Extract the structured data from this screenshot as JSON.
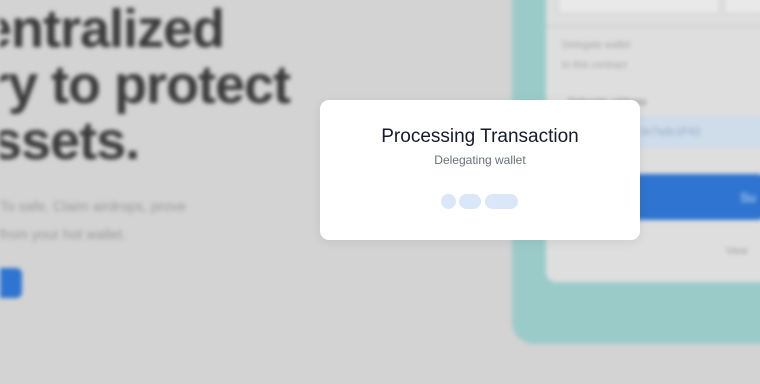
{
  "background": {
    "hero_lines": [
      "entralized",
      "ry to protect",
      "ssets."
    ],
    "subtext_lines": [
      "To safe. Claim airdrops, prove",
      "from your hot wallet."
    ],
    "side_card": {
      "info_lines": [
        "Delegate wallet",
        "to this contract"
      ],
      "field_label": "Delegate address",
      "field_value": "0x7a3c1F42",
      "submit_label": "Su",
      "footer_link": "View"
    }
  },
  "dialog": {
    "title": "Processing Transaction",
    "subtitle": "Delegating wallet"
  },
  "colors": {
    "overlay": "#d3d3d3",
    "accent": "#2f74d0",
    "panel": "#9bcbc9",
    "loader": "#d9e7f8"
  }
}
